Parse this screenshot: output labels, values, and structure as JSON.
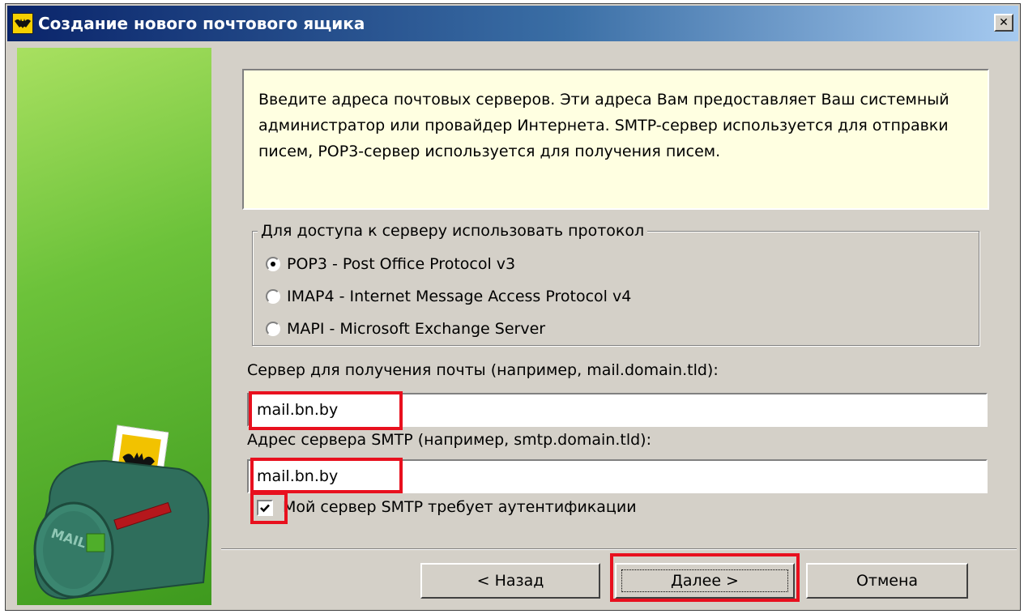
{
  "window": {
    "title": "Создание нового почтового ящика",
    "close_glyph": "✕"
  },
  "sidebar": {
    "mailbox_text": "MAIL"
  },
  "info": {
    "text": "Введите адреса почтовых серверов. Эти адреса Вам предоставляет Ваш системный администратор или провайдер Интернета. SMTP-сервер используется для отправки писем, POP3-сервер используется для получения писем."
  },
  "protocol": {
    "legend": "Для доступа к серверу использовать протокол",
    "options": [
      {
        "label": "POP3 - Post Office Protocol v3",
        "selected": true
      },
      {
        "label": "IMAP4 - Internet Message Access Protocol v4",
        "selected": false
      },
      {
        "label": "MAPI - Microsoft Exchange Server",
        "selected": false
      }
    ]
  },
  "incoming": {
    "label": "Сервер для получения почты  (например, mail.domain.tld):",
    "value": "mail.bn.by"
  },
  "smtp": {
    "label": "Адрес сервера SMTP (например, smtp.domain.tld):",
    "value": "mail.bn.by"
  },
  "auth": {
    "label": "Мой сервер SMTP требует аутентификации",
    "checked": true
  },
  "buttons": {
    "back": "< Назад",
    "next": "Далее >",
    "cancel": "Отмена"
  },
  "colors": {
    "highlight": "#e8101e",
    "info_bg": "#ffffe1",
    "dialog_bg": "#d4d0c8"
  }
}
